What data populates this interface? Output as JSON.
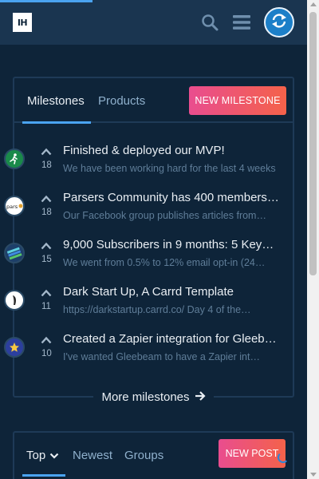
{
  "header": {
    "logo_text": "IH",
    "icons": [
      "search-icon",
      "menu-icon",
      "refresh-icon"
    ]
  },
  "milestones_panel": {
    "tabs": [
      {
        "label": "Milestones",
        "active": true
      },
      {
        "label": "Products",
        "active": false
      }
    ],
    "new_button": "NEW MILESTONE",
    "items": [
      {
        "votes": "18",
        "title": "Finished & deployed our MVP!",
        "description": "We have been working hard for the last 4 weeks",
        "avatar_icon": "running-person-icon",
        "avatar_color": "#2e9e55"
      },
      {
        "votes": "18",
        "title": "Parsers Community has 400 members…",
        "description": "Our Facebook group publishes articles from…",
        "avatar_icon": "parsers-logo-icon",
        "avatar_color": "#ffffff"
      },
      {
        "votes": "15",
        "title": "9,000 Subscribers in 9 months: 5 Key…",
        "description": "We went from 0.5% to 12% email opt-in (24…",
        "avatar_icon": "stripes-logo-icon",
        "avatar_color": "#2b6cb3"
      },
      {
        "votes": "11",
        "title": "Dark Start Up, A Carrd Template",
        "description": "https://darkstartup.carrd.co/ Day 4 of the…",
        "avatar_icon": "feather-icon",
        "avatar_color": "#ffffff"
      },
      {
        "votes": "10",
        "title": "Created a Zapier integration for Gleeb…",
        "description": "I've wanted Gleebeam to have a Zapier int…",
        "avatar_icon": "star-badge-icon",
        "avatar_color": "#3b4fb8"
      }
    ],
    "more_link": "More milestones"
  },
  "posts_panel": {
    "tabs": [
      {
        "label": "Top",
        "active": true
      },
      {
        "label": "Newest",
        "active": false
      },
      {
        "label": "Groups",
        "active": false
      }
    ],
    "new_button": "NEW POST"
  },
  "colors": {
    "background": "#0e2439",
    "header": "#1a3550",
    "accent": "#4aa3f0",
    "button_gradient_start": "#e94d8f",
    "button_gradient_end": "#f4624a"
  }
}
